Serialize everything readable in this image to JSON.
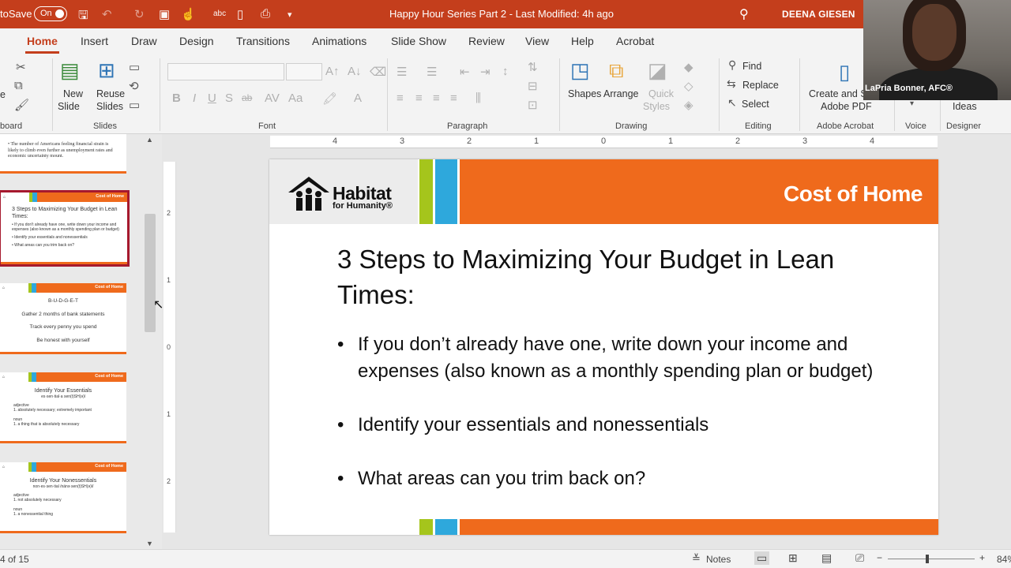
{
  "titlebar": {
    "autosave_label": "toSave",
    "autosave_state": "On",
    "doc_title": "Happy Hour Series Part 2  -  Last Modified: 4h ago",
    "user_name": "DEENA GIESEN"
  },
  "tabs": [
    "Home",
    "Insert",
    "Draw",
    "Design",
    "Transitions",
    "Animations",
    "Slide Show",
    "Review",
    "View",
    "Help",
    "Acrobat"
  ],
  "ribbon": {
    "new_slide": [
      "New",
      "Slide"
    ],
    "reuse_slides": [
      "Reuse",
      "Slides"
    ],
    "shapes": "Shapes",
    "arrange": "Arrange",
    "quick_styles": [
      "Quick",
      "Styles"
    ],
    "find": "Find",
    "replace": "Replace",
    "select": "Select",
    "create_pdf": [
      "Create and S",
      "Adobe PDF"
    ],
    "ideas": "Ideas",
    "font_buttons": [
      "B",
      "I",
      "U",
      "S",
      "ab",
      "Aa"
    ],
    "groups": {
      "clipboard": "board",
      "slides": "Slides",
      "font": "Font",
      "paragraph": "Paragraph",
      "drawing": "Drawing",
      "editing": "Editing",
      "acrobat": "Adobe Acrobat",
      "voice": "Voice",
      "designer": "Designer"
    }
  },
  "thumbnails": [
    {
      "lines": [
        "• The number of Americans feeling financial strain is likely to climb even further as unemployment rates and economic uncertainty mount."
      ]
    },
    {
      "header": "Cost of Home",
      "title": "3 Steps to Maximizing Your Budget in Lean Times:",
      "lines": [
        "• If you don't already have one, write down your income and expenses (also known as a monthly spending plan or budget)",
        "• Identify your essentials and nonessentials",
        "• What areas can you trim back on?"
      ]
    },
    {
      "header": "Cost of Home",
      "lines": [
        "B-U-D-G-E-T",
        "Gather 2 months of bank statements",
        "Track every penny you spend",
        "Be honest with yourself"
      ]
    },
    {
      "header": "Cost of Home",
      "title": "Identify Your Essentials",
      "lines": [
        "es·sen·tial·a sen(t)SH(ə)l",
        "adjective",
        "1. absolutely necessary; extremely important",
        "noun",
        "1. a thing that is absolutely necessary"
      ]
    },
    {
      "header": "Cost of Home",
      "title": "Identify Your Nonessentials",
      "lines": [
        "non·es·sen·tial /nänə sen(t)SH(ə)l/",
        "adjective",
        "1. not absolutely necessary",
        "noun",
        "1. a nonessential thing"
      ]
    }
  ],
  "ruler": {
    "h_labels": [
      "4",
      "3",
      "2",
      "1",
      "0",
      "1",
      "2",
      "3",
      "4"
    ],
    "v_labels": [
      "2",
      "1",
      "0",
      "1",
      "2"
    ]
  },
  "slide": {
    "logo_name": "Habitat",
    "logo_sub": "for Humanity®",
    "header_title": "Cost of Home",
    "title": "3 Steps to Maximizing Your Budget in Lean Times:",
    "bullets": [
      "If you don’t already have one, write down your income and expenses (also known as a monthly spending plan or budget)",
      "Identify your essentials and nonessentials",
      "What areas can you trim back on?"
    ]
  },
  "statusbar": {
    "slide_count": "4 of 15",
    "notes": "Notes",
    "zoom": "84%"
  },
  "webcam": {
    "name": "LaPria Bonner, AFC®"
  },
  "colors": {
    "accent": "#c43e1c",
    "orange": "#ef6a1c",
    "green": "#a5c51c",
    "blue": "#2ea8dc",
    "selected_border": "#a6192e"
  }
}
